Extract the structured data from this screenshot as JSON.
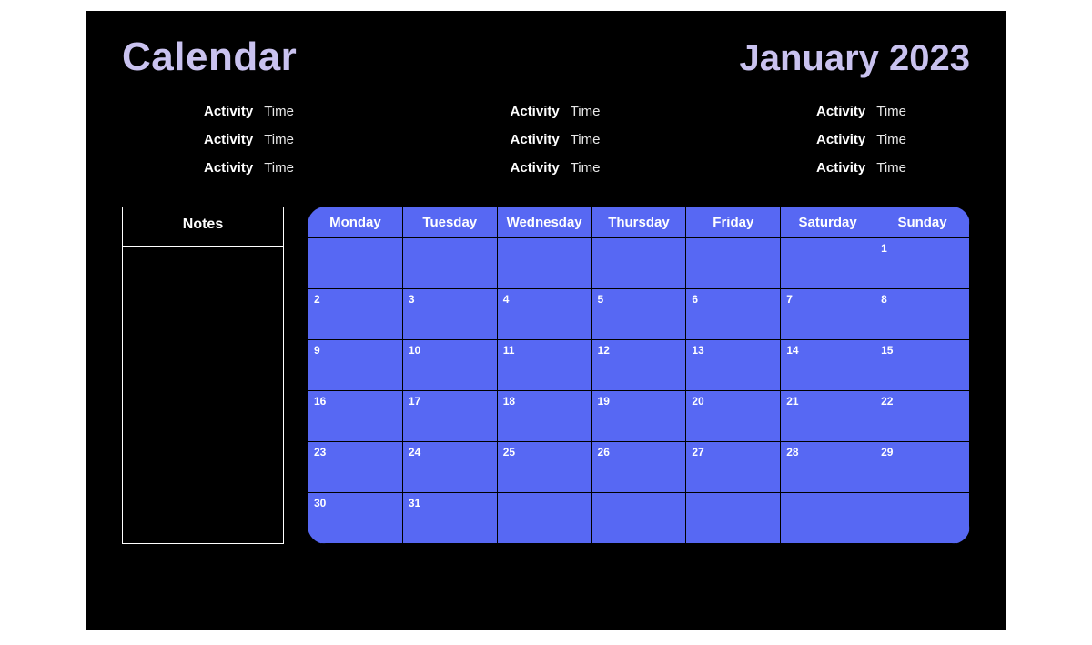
{
  "header": {
    "title": "Calendar",
    "month": "January 2023"
  },
  "activities": {
    "columns": [
      [
        {
          "label": "Activity",
          "time": "Time"
        },
        {
          "label": "Activity",
          "time": "Time"
        },
        {
          "label": "Activity",
          "time": "Time"
        }
      ],
      [
        {
          "label": "Activity",
          "time": "Time"
        },
        {
          "label": "Activity",
          "time": "Time"
        },
        {
          "label": "Activity",
          "time": "Time"
        }
      ],
      [
        {
          "label": "Activity",
          "time": "Time"
        },
        {
          "label": "Activity",
          "time": "Time"
        },
        {
          "label": "Activity",
          "time": "Time"
        }
      ]
    ]
  },
  "notes": {
    "heading": "Notes"
  },
  "calendar": {
    "weekdays": [
      "Monday",
      "Tuesday",
      "Wednesday",
      "Thursday",
      "Friday",
      "Saturday",
      "Sunday"
    ],
    "weeks": [
      [
        "",
        "",
        "",
        "",
        "",
        "",
        "1"
      ],
      [
        "2",
        "3",
        "4",
        "5",
        "6",
        "7",
        "8"
      ],
      [
        "9",
        "10",
        "11",
        "12",
        "13",
        "14",
        "15"
      ],
      [
        "16",
        "17",
        "18",
        "19",
        "20",
        "21",
        "22"
      ],
      [
        "23",
        "24",
        "25",
        "26",
        "27",
        "28",
        "29"
      ],
      [
        "30",
        "31",
        "",
        "",
        "",
        "",
        ""
      ]
    ]
  }
}
